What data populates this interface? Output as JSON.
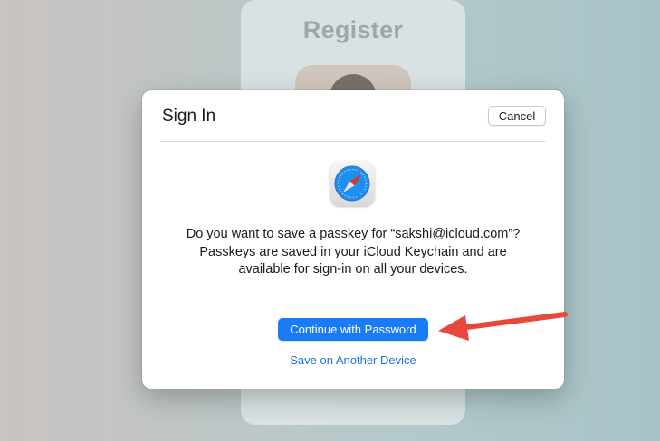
{
  "background": {
    "title": "Register"
  },
  "dialog": {
    "title": "Sign In",
    "cancel_label": "Cancel",
    "app_icon": "safari-icon",
    "message": "Do you want to save a passkey for “sakshi@icloud.com”? Passkeys are saved in your iCloud Keychain and are available for sign-in on all your devices.",
    "primary_label": "Continue with Password",
    "secondary_label": "Save on Another Device"
  },
  "annotation": {
    "arrow_icon": "red-arrow-icon",
    "arrow_color": "#e8473c"
  },
  "colors": {
    "primary_button": "#1a7cf5",
    "link": "#1a72e8"
  }
}
